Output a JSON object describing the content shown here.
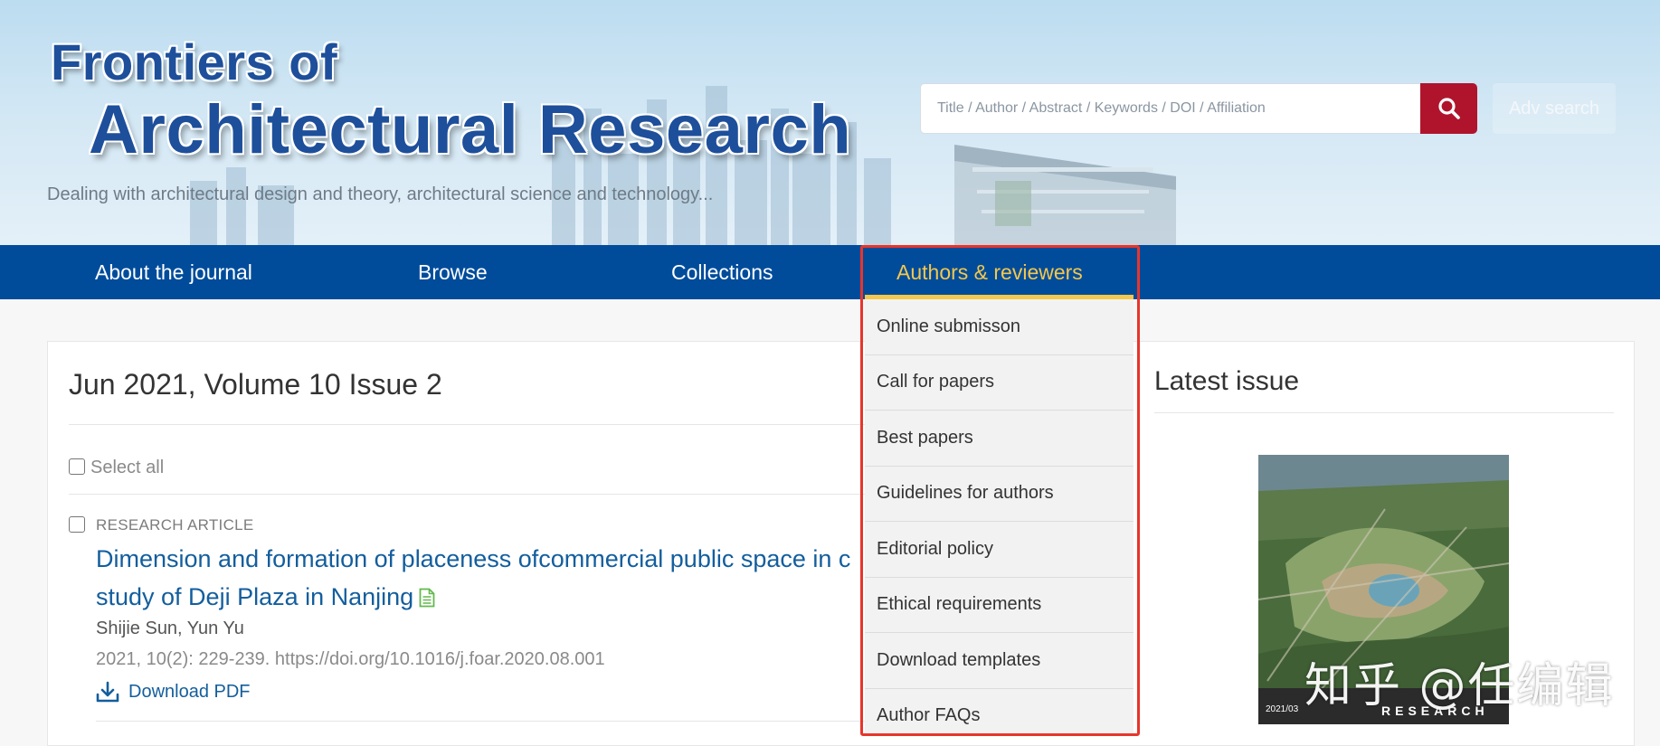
{
  "header": {
    "logo_line1": "Frontiers of",
    "logo_line2": "Architectural Research",
    "tagline": "Dealing with architectural design and theory, architectural science and technology...",
    "search_placeholder": "Title / Author / Abstract / Keywords / DOI / Affiliation",
    "search_icon": "search-icon",
    "adv_search_label": "Adv search"
  },
  "nav": {
    "items": [
      {
        "label": "About the journal",
        "active": false
      },
      {
        "label": "Browse",
        "active": false
      },
      {
        "label": "Collections",
        "active": false
      },
      {
        "label": "Authors & reviewers",
        "active": true
      }
    ]
  },
  "dropdown": {
    "items": [
      "Online submisson",
      "Call for papers",
      "Best papers",
      "Guidelines for authors",
      "Editorial policy",
      "Ethical requirements",
      "Download templates",
      "Author FAQs"
    ]
  },
  "issue": {
    "title": "Jun 2021, Volume 10 Issue 2",
    "select_all_label": "Select all"
  },
  "article": {
    "type": "RESEARCH ARTICLE",
    "title": "Dimension and formation of placeness ofcommercial public space in c",
    "title_line2": "study of Deji Plaza in Nanjing",
    "authors": "Shijie Sun, Yun Yu",
    "citation": "2021, 10(2): 229-239.   https://doi.org/10.1016/j.foar.2020.08.001",
    "download_label": "Download PDF"
  },
  "latest": {
    "title": "Latest issue",
    "cover_brand": "RESEARCH",
    "cover_date": "2021/03"
  },
  "watermark": "知乎 @任编辑",
  "colors": {
    "nav_bg": "#004c9b",
    "nav_active": "#f5c74b",
    "search_button": "#b0142d",
    "link": "#135e9d",
    "highlight_frame": "#e8352b"
  }
}
